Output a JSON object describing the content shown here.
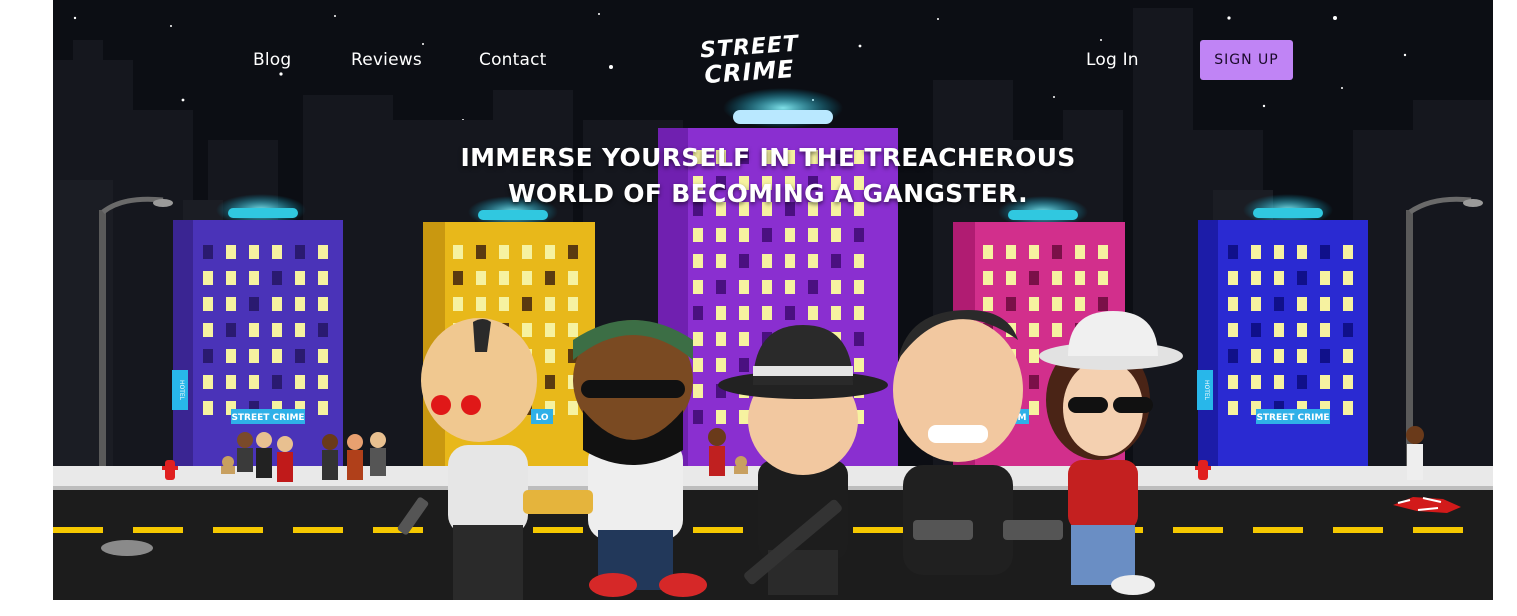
{
  "nav": {
    "blog": "Blog",
    "reviews": "Reviews",
    "contact": "Contact",
    "login": "Log In",
    "signup": "SIGN UP"
  },
  "logo": {
    "line1": "STREET",
    "line2": "CRIME"
  },
  "hero": {
    "headline_line1": "IMMERSE YOURSELF IN THE TREACHEROUS",
    "headline_line2": "WORLD OF BECOMING A GANGSTER."
  },
  "signs": {
    "hotel": "HOTEL",
    "street_crime": "STREET CRIME",
    "partial_left": "LO",
    "partial_right": "M"
  },
  "colors": {
    "sky": "#0c0e14",
    "signup_bg": "#c084f5",
    "road": "#1c1c1c",
    "lane_mark": "#f5c800",
    "sidewalk": "#e9e9e9"
  }
}
